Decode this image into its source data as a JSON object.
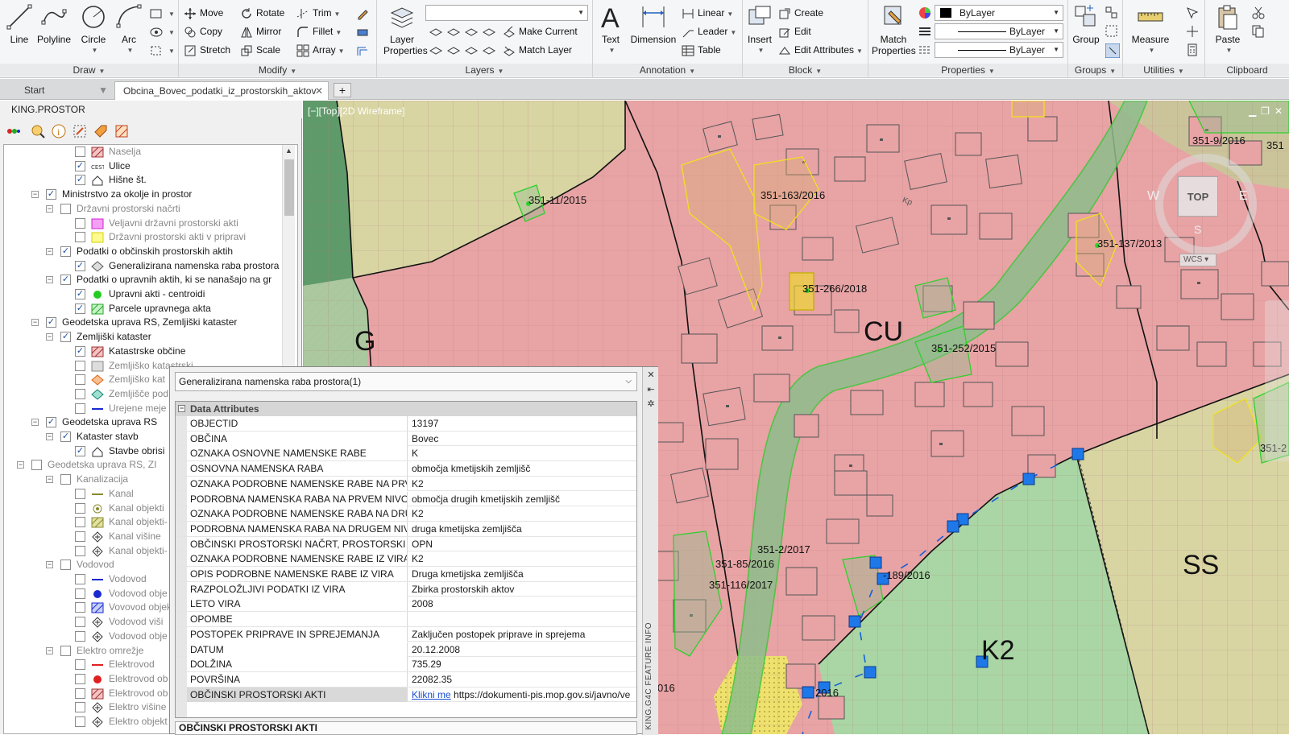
{
  "ribbon": {
    "draw": {
      "title": "Draw",
      "line": "Line",
      "polyline": "Polyline",
      "circle": "Circle",
      "arc": "Arc"
    },
    "modify": {
      "title": "Modify",
      "move": "Move",
      "rotate": "Rotate",
      "trim": "Trim",
      "copy": "Copy",
      "mirror": "Mirror",
      "fillet": "Fillet",
      "stretch": "Stretch",
      "scale": "Scale",
      "array": "Array"
    },
    "layers": {
      "title": "Layers",
      "layer_properties_1": "Layer",
      "layer_properties_2": "Properties",
      "make_current": "Make Current",
      "match_layer": "Match Layer"
    },
    "annotation": {
      "title": "Annotation",
      "text": "Text",
      "dimension": "Dimension",
      "linear": "Linear",
      "leader": "Leader",
      "table": "Table"
    },
    "block": {
      "title": "Block",
      "insert": "Insert",
      "create": "Create",
      "edit": "Edit",
      "edit_attributes": "Edit Attributes"
    },
    "properties": {
      "title": "Properties",
      "match_1": "Match",
      "match_2": "Properties",
      "color": "ByLayer",
      "linetype": "ByLayer",
      "lineweight": "ByLayer"
    },
    "groups": {
      "title": "Groups",
      "group": "Group"
    },
    "utilities": {
      "title": "Utilities",
      "measure": "Measure"
    },
    "clipboard": {
      "title": "Clipboard",
      "paste": "Paste"
    }
  },
  "tabs": {
    "start": "Start",
    "active": "Obcina_Bovec_podatki_iz_prostorskih_aktov",
    "add": "+"
  },
  "left_panel": {
    "title": "KING.PROSTOR",
    "tree": [
      {
        "label": "Naselja",
        "checked": false
      },
      {
        "label": "Ulice",
        "checked": true
      },
      {
        "label": "Hišne št.",
        "checked": true
      },
      {
        "label": "Ministrstvo za okolje in prostor",
        "checked": true
      },
      {
        "label": "Državni prostorski načrti",
        "checked": false
      },
      {
        "label": "Veljavni državni prostorski akti",
        "checked": false
      },
      {
        "label": "Državni prostorski akti v pripravi",
        "checked": false
      },
      {
        "label": "Podatki o občinskih prostorskih aktih",
        "checked": true
      },
      {
        "label": "Generalizirana namenska raba prostora",
        "checked": true
      },
      {
        "label": "Podatki o upravnih aktih, ki se nanašajo na gr",
        "checked": true
      },
      {
        "label": "Upravni akti - centroidi",
        "checked": true
      },
      {
        "label": "Parcele upravnega akta",
        "checked": true
      },
      {
        "label": "Geodetska uprava RS, Zemljiški kataster",
        "checked": true
      },
      {
        "label": "Zemljiški kataster",
        "checked": true
      },
      {
        "label": "Katastrske občine",
        "checked": true
      },
      {
        "label": "Zemljiško katastrski",
        "checked": false
      },
      {
        "label": "Zemljiško kat",
        "checked": false
      },
      {
        "label": "Zemljišče pod",
        "checked": false
      },
      {
        "label": "Urejene meje",
        "checked": false
      },
      {
        "label": "Geodetska uprava RS",
        "checked": true
      },
      {
        "label": "Kataster stavb",
        "checked": true
      },
      {
        "label": "Stavbe obrisi",
        "checked": true
      },
      {
        "label": "Geodetska uprava RS, ZI",
        "checked": false
      },
      {
        "label": "Kanalizacija",
        "checked": false
      },
      {
        "label": "Kanal",
        "checked": false
      },
      {
        "label": "Kanal objekti",
        "checked": false
      },
      {
        "label": "Kanal objekti-",
        "checked": false
      },
      {
        "label": "Kanal višine",
        "checked": false
      },
      {
        "label": "Kanal objekti-",
        "checked": false
      },
      {
        "label": "Vodovod",
        "checked": false
      },
      {
        "label": "Vodovod",
        "checked": false
      },
      {
        "label": "Vodovod obje",
        "checked": false
      },
      {
        "label": "Vovovod objek",
        "checked": false
      },
      {
        "label": "Vodovod viši",
        "checked": false
      },
      {
        "label": "Vodovod obje",
        "checked": false
      },
      {
        "label": "Elektro omrežje",
        "checked": false
      },
      {
        "label": "Elektrovod",
        "checked": false
      },
      {
        "label": "Elektrovod ob",
        "checked": false
      },
      {
        "label": "Elektrovod ob",
        "checked": false
      },
      {
        "label": "Elektro višine",
        "checked": false
      },
      {
        "label": "Elektro objekt",
        "checked": false
      }
    ]
  },
  "map": {
    "viewport_label": "[−][Top][2D Wireframe]",
    "zones": {
      "g": "G",
      "cu": "CU",
      "ss": "SS",
      "k2": "K2"
    },
    "labels": {
      "l1": "351-11/2015",
      "l2": "351-163/2016",
      "l3": "351-266/2018",
      "l4": "351-252/2015",
      "l5": "351-137/2013",
      "l6": "351-9/2016",
      "l7": "351",
      "l8": "351-2/2017",
      "l9": "351-85/2016",
      "l10": "351-116/2017",
      "l11": "-189/2016",
      "l12": "351-2",
      "l13": "016",
      "l14": "2016",
      "road": "Kp"
    },
    "viewcube": {
      "top": "TOP",
      "w": "W",
      "e": "E",
      "s": "S",
      "wcs": "WCS"
    }
  },
  "feature_info": {
    "header": "Generalizirana namenska raba prostora(1)",
    "side_title": "KING.G4C FEATURE INFO",
    "category": "Data Attributes",
    "rows": [
      {
        "name": "OBJECTID",
        "value": "13197"
      },
      {
        "name": "OBČINA",
        "value": "Bovec"
      },
      {
        "name": "OZNAKA OSNOVNE NAMENSKE RABE",
        "value": "K"
      },
      {
        "name": "OSNOVNA NAMENSKA RABA",
        "value": "območja kmetijskih zemljišč"
      },
      {
        "name": "OZNAKA PODROBNE NAMENSKE RABE NA PRVEM",
        "value": "K2"
      },
      {
        "name": "PODROBNA NAMENSKA RABA NA PRVEM NIVOJU",
        "value": "območja drugih kmetijskih zemljišč"
      },
      {
        "name": "OZNAKA PODROBNE NAMENSKE RABA NA DRUGEM",
        "value": "K2"
      },
      {
        "name": "PODROBNA NAMENSKA RABA NA DRUGEM NIVOJU",
        "value": "druga kmetijska zemljišča"
      },
      {
        "name": "OBČINSKI PROSTORSKI NAČRT, PROSTORSKI RED OI",
        "value": "OPN"
      },
      {
        "name": "OZNAKA PODROBNE NAMENSKE RABE IZ VIRA",
        "value": "K2"
      },
      {
        "name": "OPIS PODROBNE NAMENSKE RABE IZ VIRA",
        "value": "Druga kmetijska zemljišča"
      },
      {
        "name": "RAZPOLOŽLJIVI PODATKI IZ VIRA",
        "value": "Zbirka prostorskih aktov"
      },
      {
        "name": "LETO VIRA",
        "value": "2008"
      },
      {
        "name": "OPOMBE",
        "value": ""
      },
      {
        "name": "POSTOPEK PRIPRAVE IN SPREJEMANJA",
        "value": "Zaključen postopek priprave in sprejema"
      },
      {
        "name": "DATUM",
        "value": "20.12.2008"
      },
      {
        "name": "DOLŽINA",
        "value": "735.29"
      },
      {
        "name": "POVRŠINA",
        "value": "22082.35"
      }
    ],
    "last_row_name": "OBČINSKI PROSTORSKI AKTI",
    "last_row_link": "Klikni me",
    "last_row_url": "https://dokumenti-pis.mop.gov.si/javno/ve",
    "description_title": "OBČINSKI PROSTORSKI AKTI"
  }
}
